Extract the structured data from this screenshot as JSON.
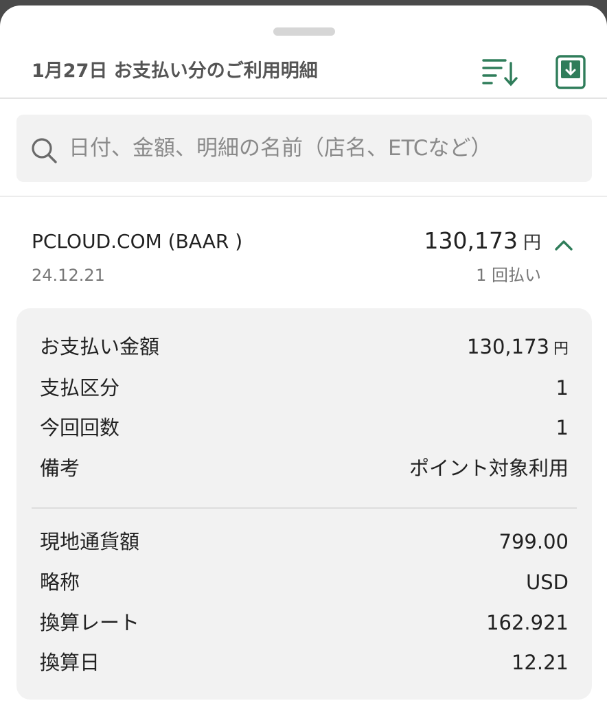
{
  "header": {
    "title": "1月27日 お支払い分のご利用明細",
    "sort_icon": "sort-descending-icon",
    "download_icon": "download-icon",
    "accent_color": "#2f7d5a"
  },
  "search": {
    "placeholder": "日付、金額、明細の名前（店名、ETCなど）",
    "value": "",
    "icon": "search-icon"
  },
  "transaction": {
    "merchant": "PCLOUD.COM (BAAR )",
    "date": "24.12.21",
    "amount": "130,173",
    "amount_unit": "円",
    "installment": "1 回払い",
    "expanded": true,
    "details": [
      {
        "label": "お支払い金額",
        "value": "130,173",
        "unit": "円"
      },
      {
        "label": "支払区分",
        "value": "1"
      },
      {
        "label": "今回回数",
        "value": "1"
      },
      {
        "label": "備考",
        "value": "ポイント対象利用"
      }
    ],
    "currency_details": [
      {
        "label": "現地通貨額",
        "value": "799.00"
      },
      {
        "label": "略称",
        "value": "USD"
      },
      {
        "label": "換算レート",
        "value": "162.921"
      },
      {
        "label": "換算日",
        "value": "12.21"
      }
    ]
  }
}
